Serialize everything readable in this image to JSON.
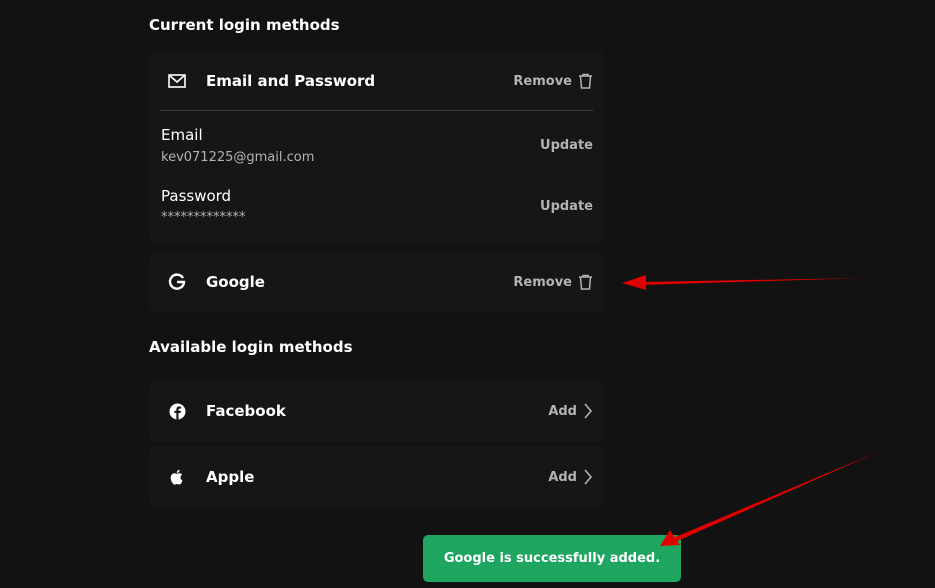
{
  "current_section": {
    "title": "Current login methods",
    "email_password": {
      "label": "Email and Password",
      "remove_label": "Remove",
      "email_title": "Email",
      "email_value": "kev071225@gmail.com",
      "email_action": "Update",
      "password_title": "Password",
      "password_value": "*************",
      "password_action": "Update"
    },
    "google": {
      "label": "Google",
      "remove_label": "Remove"
    }
  },
  "available_section": {
    "title": "Available login methods",
    "facebook": {
      "label": "Facebook",
      "action": "Add"
    },
    "apple": {
      "label": "Apple",
      "action": "Add"
    }
  },
  "toast": {
    "text": "Google is successfully added."
  },
  "colors": {
    "background": "#121212",
    "toast": "#1ea660",
    "annotation_arrow": "#e00000"
  }
}
